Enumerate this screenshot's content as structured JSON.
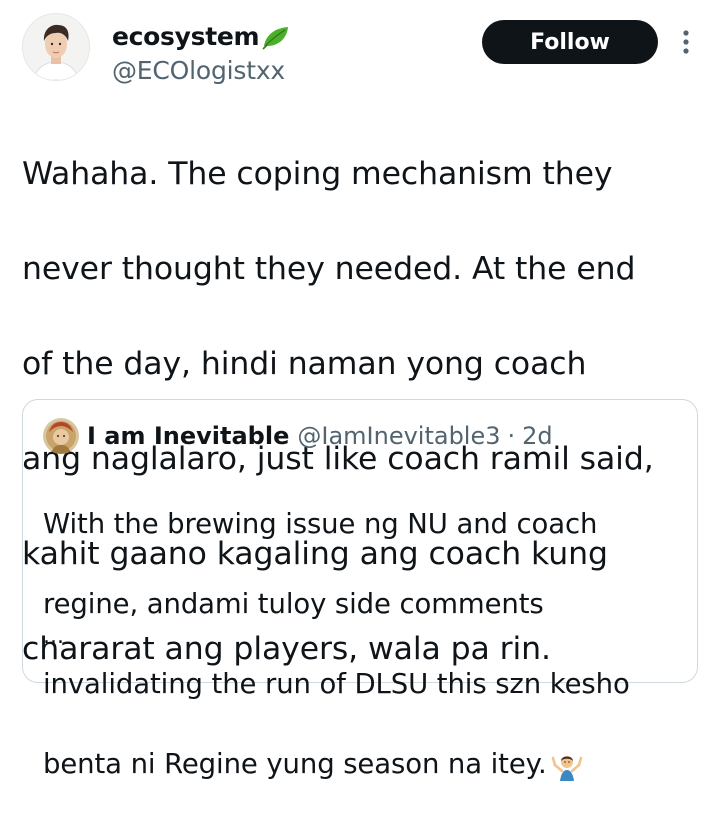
{
  "author": {
    "display_name": "ecosystem",
    "handle": "@ECOlogistxx",
    "name_badge_icon": "leaf-icon",
    "avatar_icon": "user-avatar"
  },
  "actions": {
    "follow_label": "Follow",
    "more_icon": "more-vertical-icon"
  },
  "tweet": {
    "lines": [
      "Wahaha. The coping mechanism they",
      "never thought they needed. At the end",
      "of the day, hindi naman yong coach",
      "ang naglalaro, just like coach ramil said,",
      "kahit gaano kagaling ang coach kung",
      "chararat ang players, wala pa rin."
    ]
  },
  "quote": {
    "display_name": "I am Inevitable",
    "handle": "@IamInevitable3",
    "separator": "·",
    "time": "2d",
    "lines": [
      "With the brewing issue ng NU and coach",
      "regine, andami tuloy side comments",
      "invalidating the run of DLSU this szn kesho",
      "benta ni Regine yung season na itey."
    ],
    "emoji_icon": "person-shrugging-icon",
    "ellipsis": "..."
  },
  "colors": {
    "text_primary": "#0f1419",
    "text_secondary": "#536471",
    "follow_bg": "#0f1419",
    "border": "#cfd9de",
    "leaf_green": "#4caf2a"
  }
}
